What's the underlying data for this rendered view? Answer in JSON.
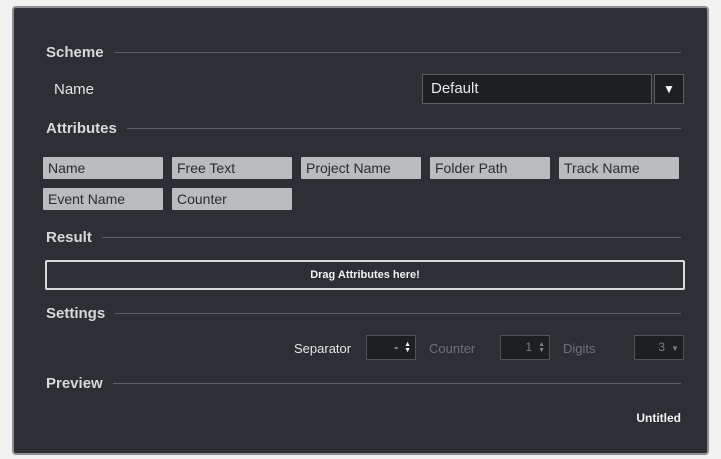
{
  "scheme": {
    "section_title": "Scheme",
    "name_label": "Name",
    "name_value": "Default",
    "dropdown_arrow": "▼"
  },
  "attributes": {
    "section_title": "Attributes",
    "items": [
      "Name",
      "Free Text",
      "Project Name",
      "Folder Path",
      "Track Name",
      "Event Name",
      "Counter"
    ]
  },
  "result": {
    "section_title": "Result",
    "dropzone_text": "Drag Attributes here!"
  },
  "settings": {
    "section_title": "Settings",
    "separator_label": "Separator",
    "separator_value": "-",
    "counter_label": "Counter",
    "counter_value": "1",
    "digits_label": "Digits",
    "digits_value": "3"
  },
  "preview": {
    "section_title": "Preview",
    "value": "Untitled"
  },
  "colors": {
    "panel_bg": "#2c2f33",
    "chip_bg": "#b9bcbf",
    "field_bg": "#1d2023",
    "disabled_text": "#6e7276"
  }
}
